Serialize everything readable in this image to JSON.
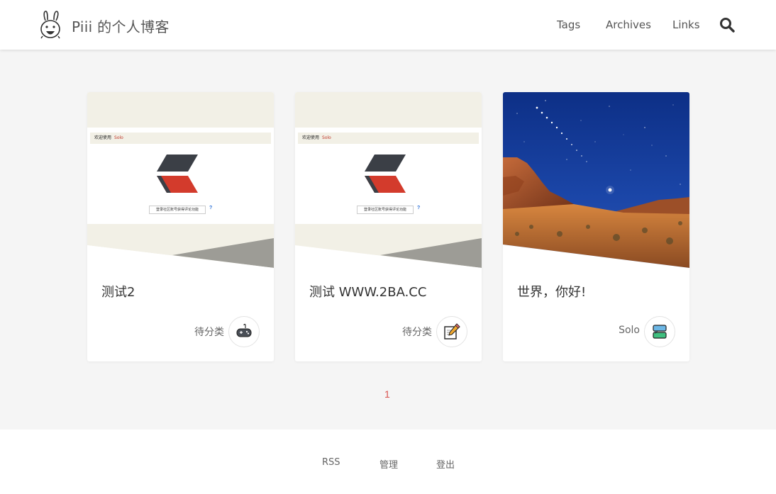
{
  "header": {
    "site_title": "Piii 的个人博客",
    "nav": [
      "Tags",
      "Archives",
      "Links"
    ]
  },
  "posts": [
    {
      "title": "测试2",
      "category": "待分类",
      "thumbnail": "solo-login-screenshot",
      "icon": "gamepad-icon"
    },
    {
      "title": "测试 WWW.2BA.CC",
      "category": "待分类",
      "thumbnail": "solo-login-screenshot",
      "icon": "memo-pencil-icon"
    },
    {
      "title": "世界，你好!",
      "category": "Solo",
      "thumbnail": "desert-night-sky-photo",
      "icon": "chat-bubbles-icon"
    }
  ],
  "mock_screenshot": {
    "bar_label": "欢迎使用",
    "bar_brand": "Solo",
    "input_text": "登录社区账号获得评论功能"
  },
  "pagination": {
    "current": "1"
  },
  "footer": {
    "links": [
      "RSS",
      "管理",
      "登出"
    ]
  },
  "colors": {
    "accent": "#d9534f",
    "header_bg": "#ffffff",
    "page_bg": "#f5f5f5"
  }
}
